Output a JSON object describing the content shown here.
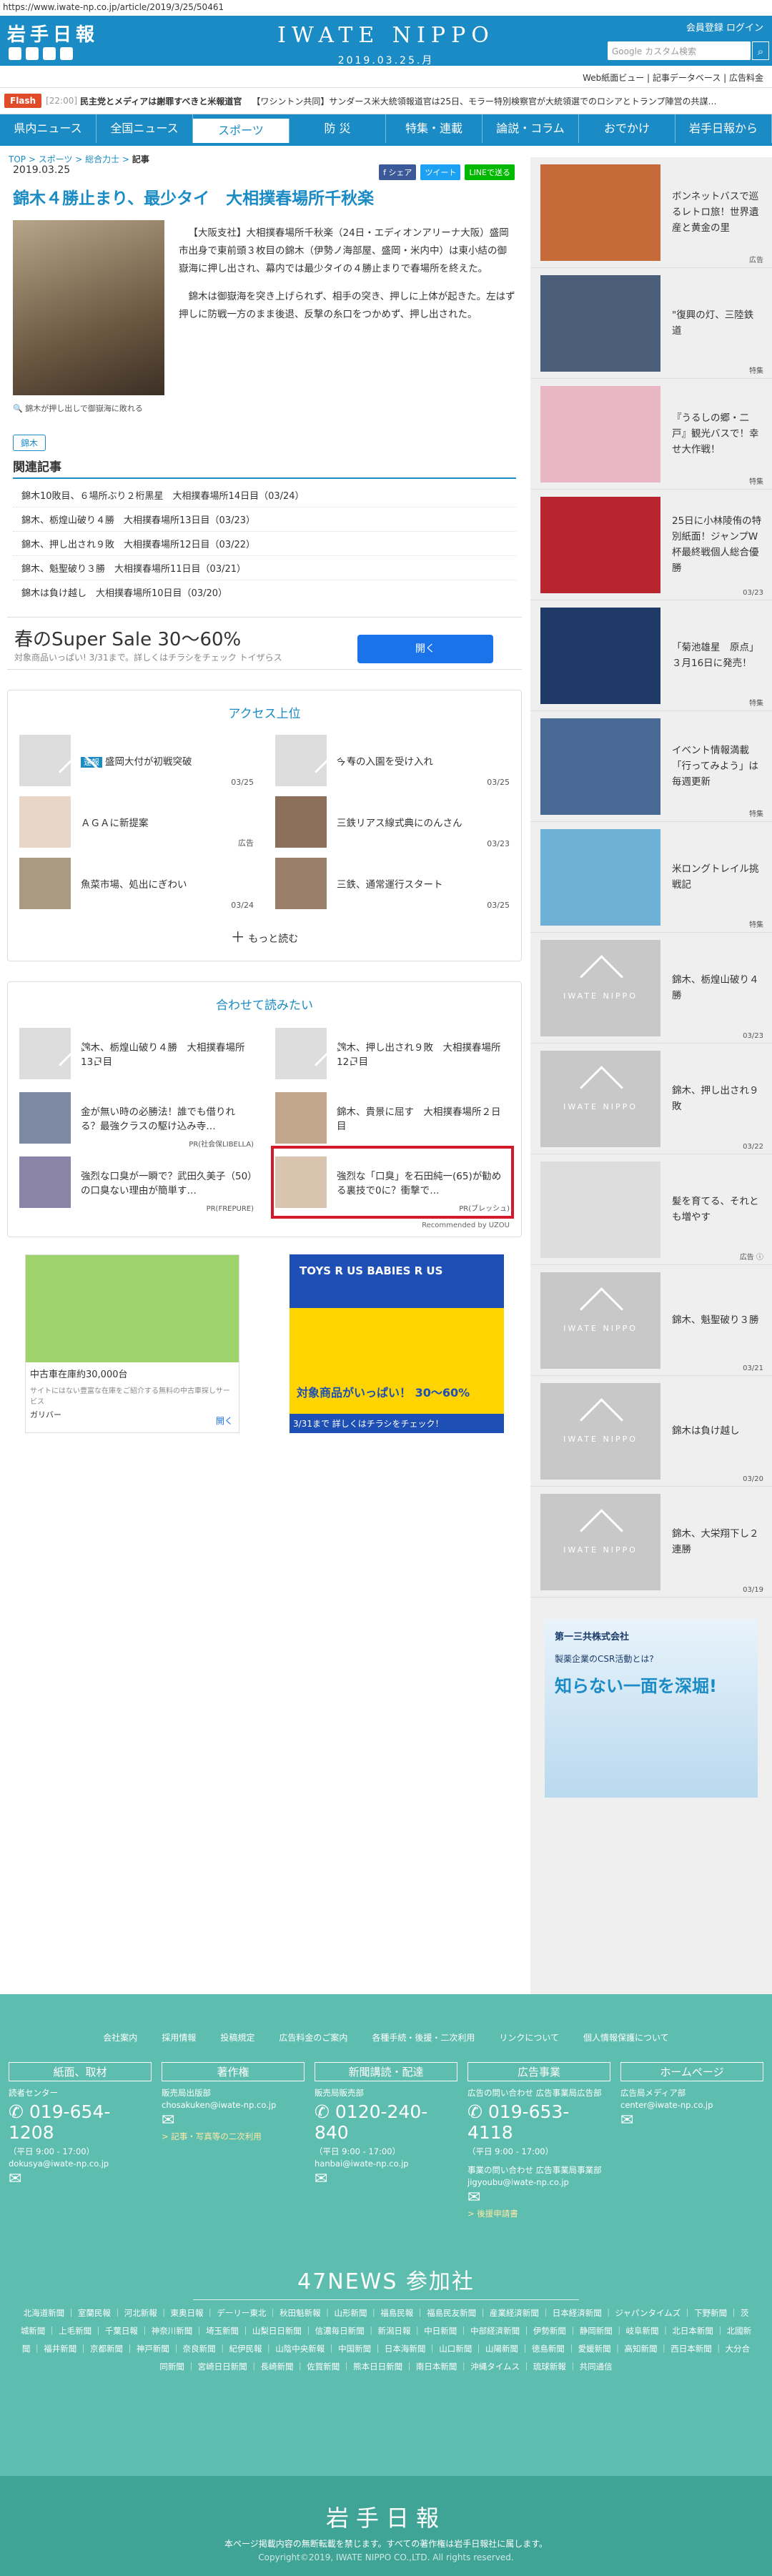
{
  "url": "https://www.iwate-np.co.jp/article/2019/3/25/50461",
  "header": {
    "logo": "岩手日報",
    "brand": "IWATE NIPPO",
    "date": "2019.03.25.月",
    "links": "会員登録  ログイン",
    "search_placeholder": "Google カスタム検索",
    "sublinks": "Web紙面ビュー  |  記事データベース  |  広告料金"
  },
  "flash": {
    "label": "Flash",
    "time": "[22:00]",
    "text": "民主党とメディアは謝罪すべきと米報道官",
    "text2": "【ワシントン共同】サンダース米大統領報道官は25日、モラー特別検察官が大統領選でのロシアとトランプ陣営の共謀…"
  },
  "nav": [
    "県内ニュース",
    "全国ニュース",
    "スポーツ",
    "防  災",
    "特集・連載",
    "論説・コラム",
    "おでかけ",
    "岩手日報から"
  ],
  "breadcrumb": [
    "TOP",
    "スポーツ",
    "総合力士",
    "記事"
  ],
  "article": {
    "date": "2019.03.25",
    "share": [
      "f シェア",
      "ツイート",
      "LINEで送る"
    ],
    "title": "錦木４勝止まり、最少タイ　大相撲春場所千秋楽",
    "caption": "錦木が押し出しで御嶽海に敗れる",
    "body": [
      "【大阪支社】大相撲春場所千秋楽（24日・エディオンアリーナ大阪）盛岡市出身で東前頭３枚目の錦木（伊勢ノ海部屋、盛岡・米内中）は東小結の御嶽海に押し出され、幕内では最少タイの４勝止まりで春場所を終えた。",
      "錦木は御嶽海を突き上げられず、相手の突き、押しに上体が起きた。左はず押しに防戦一方のまま後退、反撃の糸口をつかめず、押し出された。"
    ],
    "tag": "錦木",
    "related_title": "関連記事",
    "related": [
      "錦木10敗目、６場所ぶり２桁黒星　大相撲春場所14日目（03/24）",
      "錦木、栃煌山破り４勝　大相撲春場所13日目（03/23）",
      "錦木、押し出され９敗　大相撲春場所12日目（03/22）",
      "錦木、魁聖破り３勝　大相撲春場所11日目（03/21）",
      "錦木は負け越し　大相撲春場所10日目（03/20）"
    ]
  },
  "ad_banner": {
    "title": "春のSuper Sale 30〜60%",
    "sub": "対象商品いっぱい! 3/31まで。詳しくはチラシをチェック トイザらス",
    "button": "開く"
  },
  "ranking": {
    "title": "アクセス上位",
    "items": [
      {
        "text": "盛岡大付が初戦突破",
        "badge": "速報",
        "date": "03/25"
      },
      {
        "text": "今春の入園を受け入れ",
        "date": "03/25"
      },
      {
        "text": "ＡＧＡに新提案",
        "date": "広告"
      },
      {
        "text": "三鉄リアス線式典にのんさん",
        "date": "03/23"
      },
      {
        "text": "魚菜市場、処出にぎわい",
        "date": "03/24"
      },
      {
        "text": "三鉄、通常運行スタート",
        "date": "03/25"
      }
    ],
    "more": "もっと読む"
  },
  "recommend": {
    "title": "合わせて読みたい",
    "items": [
      {
        "text": "錦木、栃煌山破り４勝　大相撲春場所13日目"
      },
      {
        "text": "錦木、押し出され９敗　大相撲春場所12日目"
      },
      {
        "text": "金が無い時の必勝法！誰でも借りれる？最強クラスの駆け込み寺…",
        "pr": "PR(社会保LIBELLA)"
      },
      {
        "text": "錦木、貴景に屈す　大相撲春場所２日目"
      },
      {
        "text": "強烈な口臭が一瞬で？武田久美子（50）の口臭ない理由が簡単す…",
        "pr": "PR(FREPURE)"
      },
      {
        "text": "強烈な「口臭」を石田純一(65)が勧める裏技で0に？衝撃で…",
        "pr": "PR(ブレッシュ)"
      }
    ],
    "credit": "Recommended by UZOU"
  },
  "ad_gulliver": {
    "title": "中古車在庫約30,000台",
    "sub": "サイトにはない豊富な在庫をご紹介する無料の中古車探しサービス",
    "brand": "ガリバー",
    "btn": "開く"
  },
  "ad_toys": {
    "title": "TOYS R US  BABIES R US",
    "sub": "対象商品がいっぱい！ 30〜60%",
    "foot": "3/31まで 詳しくはチラシをチェック！"
  },
  "side": [
    {
      "text": "ボンネットバスで巡るレトロ旅！世界遺産と黄金の里",
      "date": "広告"
    },
    {
      "text": "\"復興の灯、三陸鉄道",
      "date": "特集"
    },
    {
      "text": "『うるしの郷・二戸』観光バスで！幸せ大作戦！",
      "date": "特集"
    },
    {
      "text": "25日に小林陵侑の特別紙面！ジャンプW杯最終戦個人総合優勝",
      "date": "03/23"
    },
    {
      "text": "「菊池雄星　原点」３月16日に発売！",
      "date": "特集"
    },
    {
      "text": "イベント情報満載「行ってみよう」は毎週更新",
      "date": "特集"
    },
    {
      "text": "米ロングトレイル挑戦記",
      "date": "特集"
    },
    {
      "text": "錦木、栃煌山破り４勝",
      "date": "03/23"
    },
    {
      "text": "錦木、押し出され９敗",
      "date": "03/22"
    },
    {
      "text": "髪を育てる、それとも増やす",
      "date": "広告 ⓘ"
    },
    {
      "text": "錦木、魁聖破り３勝",
      "date": "03/21"
    },
    {
      "text": "錦木は負け越し",
      "date": "03/20"
    },
    {
      "text": "錦木、大栄翔下し２連勝",
      "date": "03/19"
    }
  ],
  "side_ad": {
    "brand": "第一三共株式会社",
    "line1": "製薬企業のCSR活動とは?",
    "line2": "知らない一面を深堀!"
  },
  "footer": {
    "links": [
      "会社案内",
      "採用情報",
      "投稿規定",
      "広告料金のご案内",
      "各種手続・後援・二次利用",
      "リンクについて",
      "個人情報保護について"
    ],
    "cols": [
      {
        "h": "紙面、取材",
        "l1": "読者センター",
        "phone": "019-654-1208",
        "hours": "（平日 9:00 - 17:00）",
        "mail": "dokusya@iwate-np.co.jp"
      },
      {
        "h": "著作権",
        "l1": "販売局出版部",
        "mail": "chosakuken@iwate-np.co.jp",
        "link": "> 記事・写真等の二次利用"
      },
      {
        "h": "新聞講読・配達",
        "l1": "販売局販売部",
        "phone": "0120-240-840",
        "hours": "（平日 9:00 - 17:00）",
        "mail": "hanbai@iwate-np.co.jp"
      },
      {
        "h": "広告事業",
        "l1": "広告の問い合わせ 広告事業局広告部",
        "phone": "019-653-4118",
        "hours": "（平日 9:00 - 17:00）",
        "l2": "事業の問い合わせ 広告事業局事業部",
        "mail": "jigyoubu@iwate-np.co.jp",
        "link": "> 後援申請書"
      },
      {
        "h": "ホームページ",
        "l1": "広告局メディア部",
        "mail": "center@iwate-np.co.jp"
      }
    ],
    "p47": "47NEWS 参加社",
    "papers": "北海道新聞 ｜ 室蘭民報 ｜ 河北新報 ｜ 東奥日報 ｜ デーリー東北 ｜ 秋田魁新報 ｜ 山形新聞 ｜ 福島民報 ｜ 福島民友新聞 ｜ 産業経済新聞 ｜ 日本経済新聞 ｜ ジャパンタイムズ ｜ 下野新聞 ｜ 茨城新聞 ｜ 上毛新聞 ｜ 千葉日報 ｜ 神奈川新聞 ｜ 埼玉新聞 ｜ 山梨日日新聞 ｜ 信濃毎日新聞 ｜ 新潟日報 ｜ 中日新聞 ｜ 中部経済新聞 ｜ 伊勢新聞 ｜ 静岡新聞 ｜ 岐阜新聞 ｜ 北日本新聞 ｜ 北國新聞 ｜ 福井新聞 ｜ 京都新聞 ｜ 神戸新聞 ｜ 奈良新聞 ｜ 紀伊民報 ｜ 山陰中央新報 ｜ 中国新聞 ｜ 日本海新聞 ｜ 山口新聞 ｜ 山陽新聞 ｜ 徳島新聞 ｜ 愛媛新聞 ｜ 高知新聞 ｜ 西日本新聞 ｜ 大分合同新聞 ｜ 宮崎日日新聞 ｜ 長崎新聞 ｜ 佐賀新聞 ｜ 熊本日日新聞 ｜ 南日本新聞 ｜ 沖縄タイムス ｜ 琉球新報 ｜ 共同通信",
    "logo": "岩手日報",
    "notice": "本ページ掲載内容の無断転載を禁じます。すべての著作権は岩手日報社に属します。",
    "copy": "Copyright©2019, IWATE NIPPO CO.,LTD. All rights reserved."
  },
  "colors": {
    "brand": "#1a8bc4",
    "footer": "#5dbdae",
    "highlight": "#d4192b"
  }
}
